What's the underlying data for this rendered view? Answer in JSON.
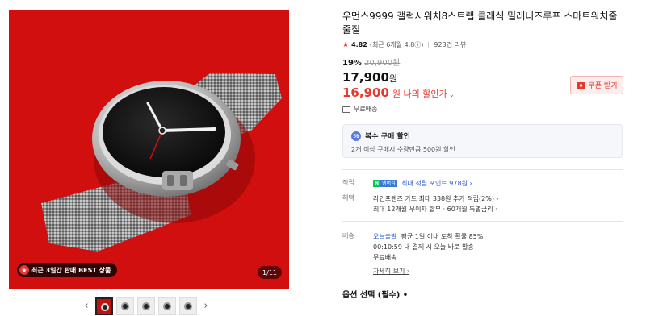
{
  "gallery": {
    "best_badge": "최근 3일간 판매 BEST 상품",
    "counter": "1/11",
    "prev_icon": "chevron-left-icon",
    "next_icon": "chevron-right-icon",
    "thumb_count": 5
  },
  "product": {
    "title": "우먼스9999 갤럭시워치8스트랩 클래식 밀레니즈루프 스마트워치줄 줄질",
    "rating": "4.82",
    "recent_rating": "(최근 6개월 4.8ⓘ)",
    "review_count": "923건 리뷰",
    "discount_pct": "19%",
    "original_price": "20,900원",
    "price": "17,900",
    "currency": "원",
    "my_price": "16,900",
    "my_price_label": "원 나의 할인가",
    "coupon_button": "쿠폰 받기",
    "shipping_fee": "무료배송"
  },
  "bundle": {
    "title": "복수 구매 할인",
    "description": "2개 이상 구매시 수량만큼 500원 할인"
  },
  "benefits": {
    "points_key": "적립",
    "points_badge_n": "N",
    "points_badge_p": "멤버십",
    "points_text": "최대 적립 포인트 978원",
    "benefit_key": "혜택",
    "benefit_line1": "라인프렌즈 카드 최대 338원 추가 적립(2%)",
    "benefit_line2": "최대 12개월 무이자 할부 · 60개월 특별금리"
  },
  "delivery": {
    "key": "배송",
    "today": "오늘출발",
    "today_rate": "평균 1일 이내 도착 확률 85%",
    "deadline": "00:10:59  내 결제 시 오늘 바로 발송",
    "fee": "무료배송",
    "detail_link": "자세히 보기"
  },
  "options": {
    "label": "옵션 선택 (필수) •"
  },
  "colors": {
    "accent": "#e8372b",
    "hero_bg": "#d10f0f",
    "link": "#2b57c7"
  }
}
